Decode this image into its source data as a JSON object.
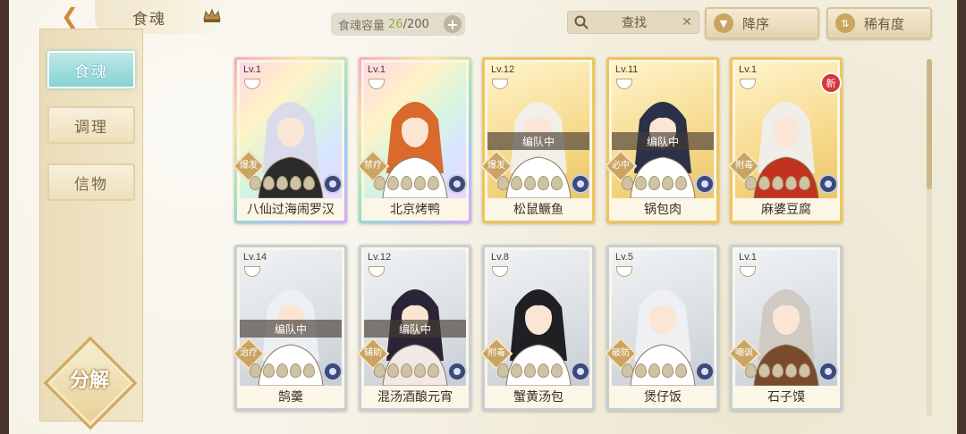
{
  "header": {
    "title": "食魂",
    "capacity_label": "食魂容量",
    "capacity_current": "26",
    "capacity_max": "/200",
    "capacity_add": "+",
    "search_placeholder": "查找",
    "search_clear": "✕",
    "sort_order_label": "降序",
    "sort_by_label": "稀有度"
  },
  "sidebar": {
    "items": [
      {
        "label": "食魂",
        "active": true
      },
      {
        "label": "调理",
        "active": false
      },
      {
        "label": "信物",
        "active": false
      }
    ],
    "decompose_label": "分解"
  },
  "colors": {
    "rainbow": "#f7a8c8",
    "gold": "#f0c557",
    "silver": "#c6cfd6",
    "active_tab": "#86d2d2",
    "accent": "#d38a3a"
  },
  "team_tag_text": "编队中",
  "new_badge_text": "新",
  "cards": [
    {
      "level": "Lv.1",
      "name": "八仙过海闹罗汉",
      "role": "爆发",
      "rarity": "rainbow",
      "in_team": false,
      "is_new": false,
      "stars_lit": 0,
      "hair": "#d9dbea",
      "robe": "#2b2b2b"
    },
    {
      "level": "Lv.1",
      "name": "北京烤鸭",
      "role": "禁疗",
      "rarity": "rainbow",
      "in_team": false,
      "is_new": false,
      "stars_lit": 0,
      "hair": "#d96a2b",
      "robe": "#ffffff"
    },
    {
      "level": "Lv.12",
      "name": "松鼠鳜鱼",
      "role": "爆发",
      "rarity": "gold",
      "in_team": true,
      "is_new": false,
      "stars_lit": 0,
      "hair": "#f2eee8",
      "robe": "#ffffff"
    },
    {
      "level": "Lv.11",
      "name": "锅包肉",
      "role": "必中",
      "rarity": "gold",
      "in_team": true,
      "is_new": false,
      "stars_lit": 0,
      "hair": "#2a3148",
      "robe": "#ffffff"
    },
    {
      "level": "Lv.1",
      "name": "麻婆豆腐",
      "role": "附毒",
      "rarity": "gold",
      "in_team": false,
      "is_new": true,
      "stars_lit": 0,
      "hair": "#f1eeea",
      "robe": "#c2331f"
    },
    {
      "level": "Lv.14",
      "name": "鹄羹",
      "role": "治疗",
      "rarity": "silver",
      "in_team": true,
      "is_new": false,
      "stars_lit": 0,
      "hair": "#eceff3",
      "robe": "#ffffff"
    },
    {
      "level": "Lv.12",
      "name": "混汤酒酿元宵",
      "role": "辅助",
      "rarity": "silver",
      "in_team": true,
      "is_new": false,
      "stars_lit": 0,
      "hair": "#2a2436",
      "robe": "#f2e8e8"
    },
    {
      "level": "Lv.8",
      "name": "蟹黄汤包",
      "role": "附毒",
      "rarity": "silver",
      "in_team": false,
      "is_new": false,
      "stars_lit": 0,
      "hair": "#1f1f24",
      "robe": "#ffffff"
    },
    {
      "level": "Lv.5",
      "name": "煲仔饭",
      "role": "破防",
      "rarity": "silver",
      "in_team": false,
      "is_new": false,
      "stars_lit": 0,
      "hair": "#eef0f4",
      "robe": "#ffffff"
    },
    {
      "level": "Lv.1",
      "name": "石子馍",
      "role": "嘲讽",
      "rarity": "silver",
      "in_team": false,
      "is_new": false,
      "stars_lit": 0,
      "hair": "#cfcac2",
      "robe": "#7a4a2c"
    }
  ]
}
